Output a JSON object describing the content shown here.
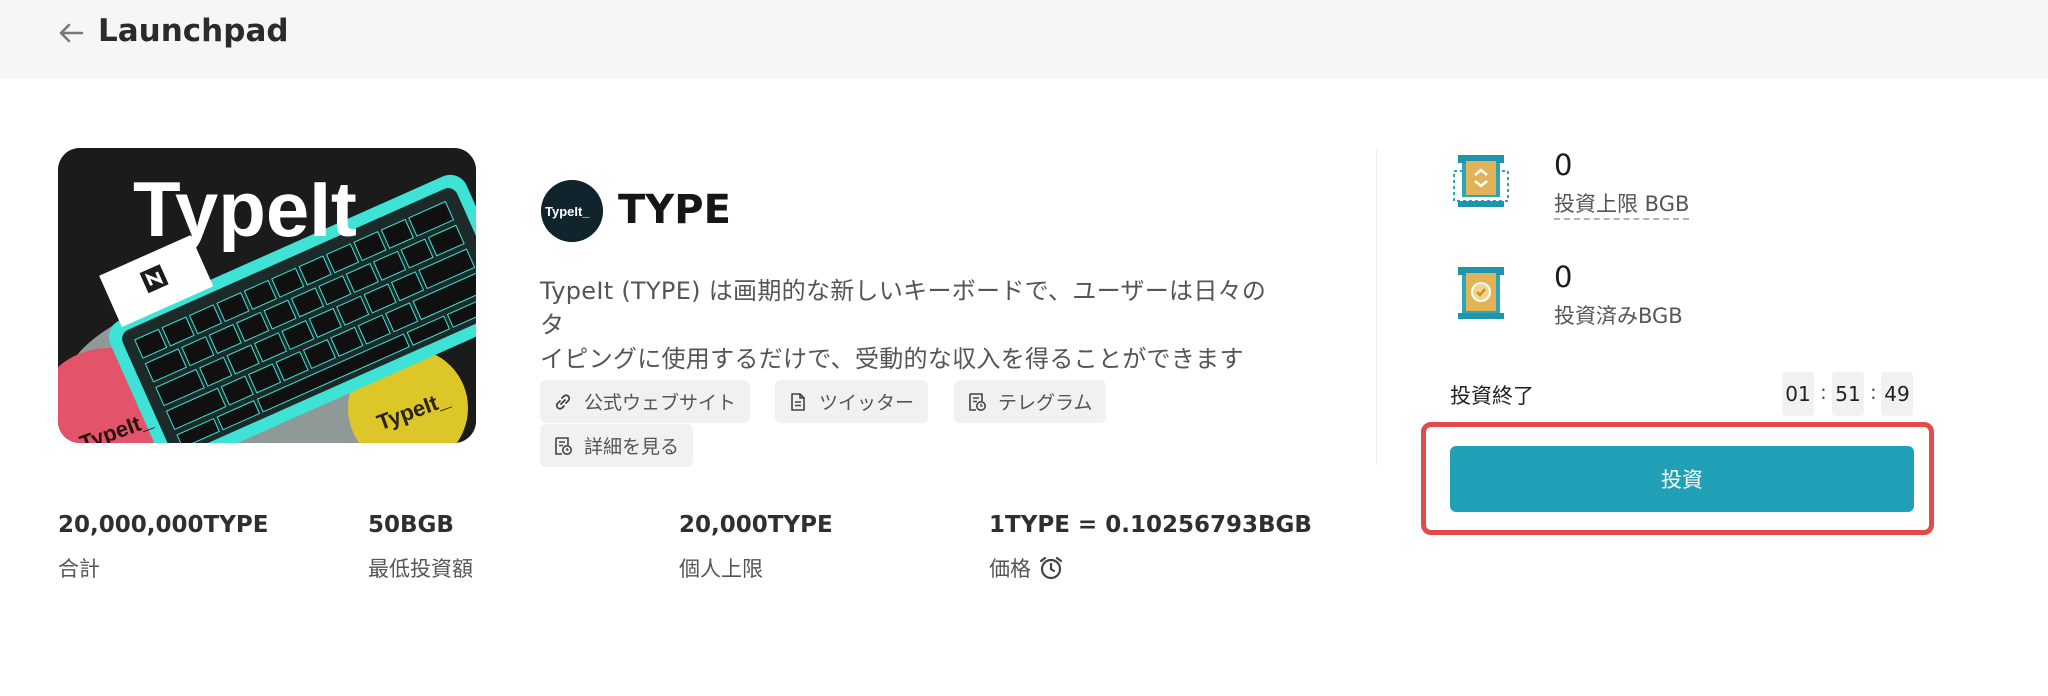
{
  "header": {
    "title": "Launchpad",
    "back_icon": "arrow-left-icon"
  },
  "banner": {
    "headline": "TypeIt",
    "sticker_text": "TypeIt_",
    "logo_text": "TypeIt_"
  },
  "project": {
    "name": "TYPE",
    "description_line1": "TypeIt (TYPE) は画期的な新しいキーボードで、ユーザーは日々のタ",
    "description_line2": "イピングに使用するだけで、受動的な収入を得ることができます",
    "links": {
      "website": "公式ウェブサイト",
      "twitter": "ツイッター",
      "telegram": "テレグラム",
      "details": "詳細を見る"
    }
  },
  "stats": [
    {
      "value": "20,000,000TYPE",
      "label": "合計"
    },
    {
      "value": "50BGB",
      "label": "最低投資額"
    },
    {
      "value": "20,000TYPE",
      "label": "個人上限"
    },
    {
      "value": "1TYPE = 0.10256793BGB",
      "label": "価格"
    }
  ],
  "side": {
    "limit_value": "0",
    "limit_label": "投資上限 BGB",
    "invested_value": "0",
    "invested_label": "投資済みBGB",
    "end_label": "投資終了",
    "timer": {
      "hours": "01",
      "minutes": "51",
      "seconds": "49"
    },
    "invest_button": "投資"
  },
  "colors": {
    "accent": "#22a0b8",
    "highlight": "#e54a4a",
    "gold": "#e2b356"
  }
}
